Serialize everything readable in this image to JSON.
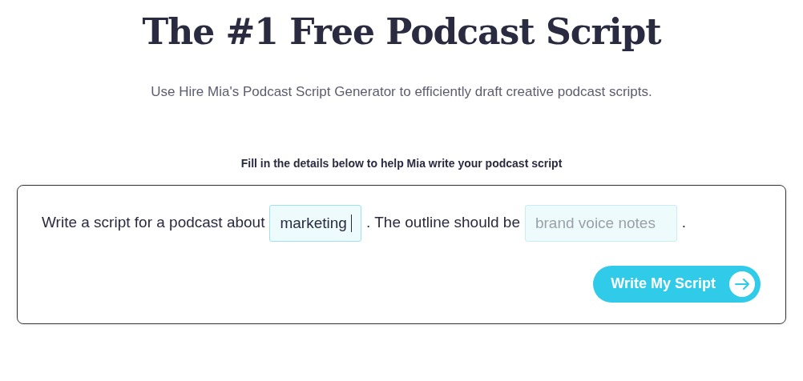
{
  "title": "The #1 Free Podcast Script",
  "subtitle": "Use Hire Mia's Podcast Script Generator to efficiently draft creative podcast scripts.",
  "instruction": "Fill in the details below to help Mia write your podcast script",
  "form": {
    "parts": [
      {
        "kind": "text",
        "text": "Write a script for a podcast about"
      },
      {
        "kind": "field",
        "value": "marketing",
        "focused": true
      },
      {
        "kind": "text",
        "text": ". The outline should be"
      },
      {
        "kind": "field",
        "placeholder": "brand voice notes",
        "focused": false
      },
      {
        "kind": "text",
        "text": "."
      }
    ],
    "button": "Write My Script"
  }
}
